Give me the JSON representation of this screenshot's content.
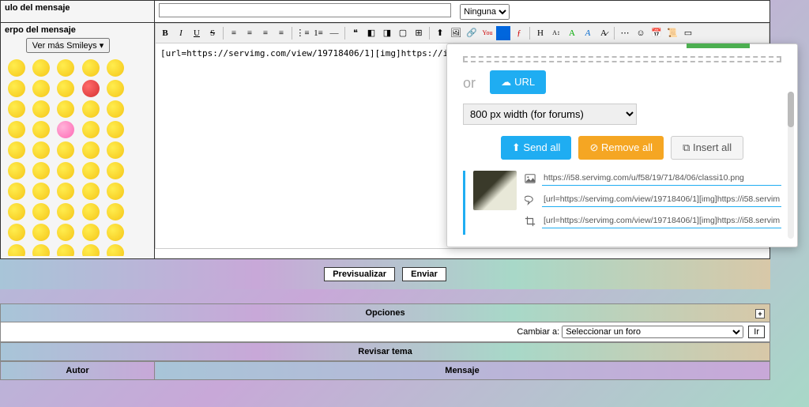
{
  "labels": {
    "title": "ulo del mensaje",
    "body": "erpo del mensaje"
  },
  "select_default": "Ninguna",
  "smiley_btn": "Ver más Smileys",
  "editor_content": "[url=https://servimg.com/view/19718406/1][img]https://i58.servim",
  "popup": {
    "or": "or",
    "url_btn": "URL",
    "width_option": "800 px width (for forums)",
    "send_all": "Send all",
    "remove_all": "Remove all",
    "insert_all": "Insert all",
    "url1": "https://i58.servimg.com/u/f58/19/71/84/06/classi10.png",
    "url2": "[url=https://servimg.com/view/19718406/1][img]https://i58.servimg",
    "url3": "[url=https://servimg.com/view/19718406/1][img]https://i58.servimg"
  },
  "buttons": {
    "preview": "Previsualizar",
    "send": "Enviar"
  },
  "sections": {
    "options": "Opciones",
    "review": "Revisar tema",
    "change_to": "Cambiar a:",
    "select_forum": "Seleccionar un foro",
    "go": "Ir",
    "author": "Autor",
    "message": "Mensaje"
  }
}
